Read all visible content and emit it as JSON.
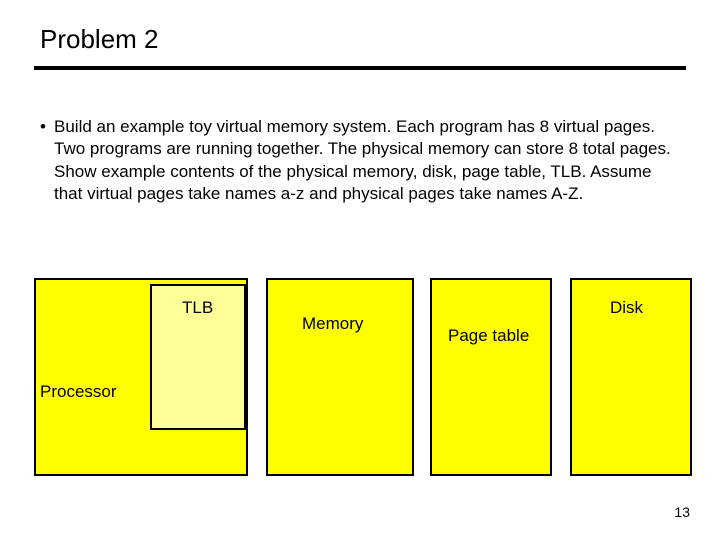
{
  "title": "Problem 2",
  "bullet": "Build an example toy virtual memory system.  Each program has 8 virtual pages.  Two programs are running together.  The physical memory can store 8 total pages.  Show example contents of the physical memory, disk, page table, TLB.  Assume that virtual pages take names a-z and physical pages take names A-Z.",
  "labels": {
    "tlb": "TLB",
    "memory": "Memory",
    "pagetable": "Page table",
    "disk": "Disk",
    "processor": "Processor"
  },
  "page_number": "13"
}
